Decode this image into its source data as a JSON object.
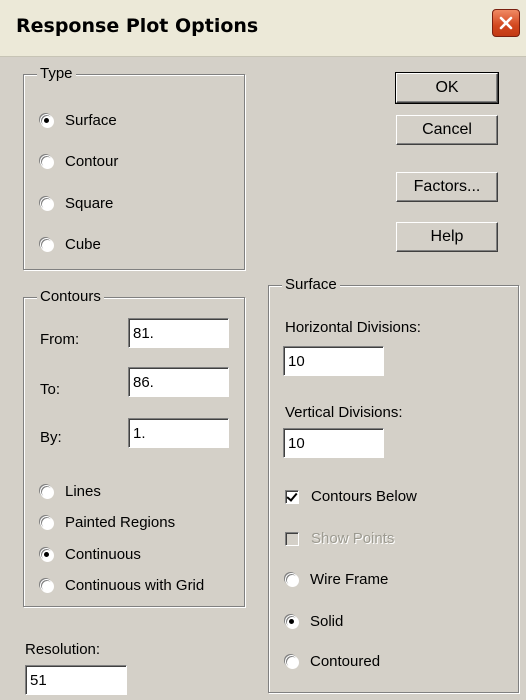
{
  "window": {
    "title": "Response Plot Options"
  },
  "type_group": {
    "legend": "Type",
    "options": [
      {
        "label": "Surface",
        "selected": true
      },
      {
        "label": "Contour",
        "selected": false
      },
      {
        "label": "Square",
        "selected": false
      },
      {
        "label": "Cube",
        "selected": false
      }
    ]
  },
  "buttons": {
    "ok": "OK",
    "cancel": "Cancel",
    "factors": "Factors...",
    "help": "Help"
  },
  "contours": {
    "legend": "Contours",
    "from_label": "From:",
    "from_value": "81.",
    "to_label": "To:",
    "to_value": "86.",
    "by_label": "By:",
    "by_value": "1.",
    "options": [
      {
        "label": "Lines",
        "selected": false
      },
      {
        "label": "Painted Regions",
        "selected": false
      },
      {
        "label": "Continuous",
        "selected": true
      },
      {
        "label": "Continuous with Grid",
        "selected": false
      }
    ]
  },
  "resolution": {
    "label": "Resolution:",
    "value": "51"
  },
  "surface": {
    "legend": "Surface",
    "hdiv_label": "Horizontal Divisions:",
    "hdiv_value": "10",
    "vdiv_label": "Vertical Divisions:",
    "vdiv_value": "10",
    "contours_below": {
      "label": "Contours Below",
      "checked": true
    },
    "show_points": {
      "label": "Show Points",
      "checked": false,
      "disabled": true
    },
    "options": [
      {
        "label": "Wire Frame",
        "selected": false
      },
      {
        "label": "Solid",
        "selected": true
      },
      {
        "label": "Contoured",
        "selected": false
      }
    ]
  },
  "colors": {
    "title_bar": "#ece9d8",
    "dialog": "#d4d0c8",
    "close_button": "#d2471f"
  },
  "icons": {
    "close": "close-icon"
  }
}
